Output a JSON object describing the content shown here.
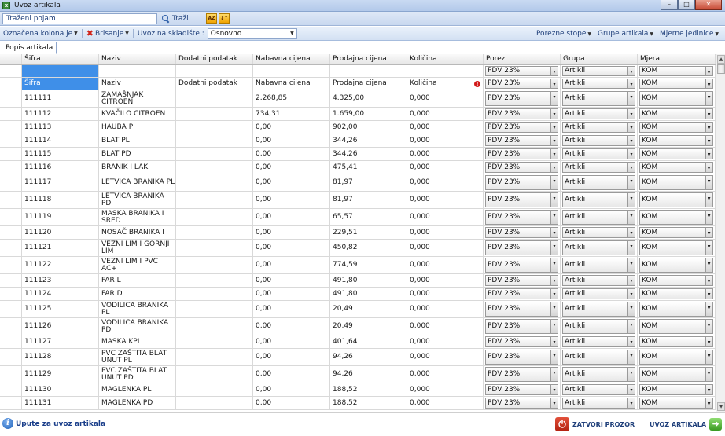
{
  "window": {
    "title": "Uvoz artikala",
    "minimize": "–",
    "maximize": "□",
    "close": "✕"
  },
  "search": {
    "value": "Traženi pojam",
    "button_label": "Traži",
    "sort_az_label": "AZ",
    "sort_desc_label": "↓↑"
  },
  "toolbar": {
    "marked_column_label": "Označena kolona je",
    "delete_label": "Brisanje",
    "import_to_warehouse_label": "Uvoz na skladište :",
    "warehouse_value": "Osnovno",
    "tax_rates_label": "Porezne stope",
    "item_groups_label": "Grupe artikala",
    "units_label": "Mjerne jedinice"
  },
  "tab": {
    "label": "Popis artikala"
  },
  "columns": [
    "Šifra",
    "Naziv",
    "Dodatni podatak",
    "Nabavna cijena",
    "Prodajna cijena",
    "Količina",
    "Porez",
    "Grupa",
    "Mjera"
  ],
  "filter_row": {
    "porez": "PDV 23%",
    "grupa": "Artikli",
    "mjera": "KOM"
  },
  "colname_row": [
    "Šifra",
    "Naziv",
    "Dodatni podatak",
    "Nabavna cijena",
    "Prodajna cijena",
    "Količina",
    "PDV 23%",
    "Artikli",
    "KOM"
  ],
  "rows": [
    {
      "sifra": "111111",
      "naziv": "ZAMAŠNJAK CITROEN",
      "dodatni": "",
      "nabavna": "2.268,85",
      "prodajna": "4.325,00",
      "kolicina": "0,000",
      "porez": "PDV 23%",
      "grupa": "Artikli",
      "mjera": "KOM"
    },
    {
      "sifra": "111112",
      "naziv": "KVAČILO CITROEN",
      "dodatni": "",
      "nabavna": "734,31",
      "prodajna": "1.659,00",
      "kolicina": "0,000",
      "porez": "PDV 23%",
      "grupa": "Artikli",
      "mjera": "KOM"
    },
    {
      "sifra": "111113",
      "naziv": "HAUBA P",
      "dodatni": "",
      "nabavna": "0,00",
      "prodajna": "902,00",
      "kolicina": "0,000",
      "porez": "PDV 23%",
      "grupa": "Artikli",
      "mjera": "KOM"
    },
    {
      "sifra": "111114",
      "naziv": "BLAT PL",
      "dodatni": "",
      "nabavna": "0,00",
      "prodajna": "344,26",
      "kolicina": "0,000",
      "porez": "PDV 23%",
      "grupa": "Artikli",
      "mjera": "KOM"
    },
    {
      "sifra": "111115",
      "naziv": "BLAT PD",
      "dodatni": "",
      "nabavna": "0,00",
      "prodajna": "344,26",
      "kolicina": "0,000",
      "porez": "PDV 23%",
      "grupa": "Artikli",
      "mjera": "KOM"
    },
    {
      "sifra": "111116",
      "naziv": "BRANIK I LAK",
      "dodatni": "",
      "nabavna": "0,00",
      "prodajna": "475,41",
      "kolicina": "0,000",
      "porez": "PDV 23%",
      "grupa": "Artikli",
      "mjera": "KOM"
    },
    {
      "sifra": "111117",
      "naziv": "LETVICA BRANIKA PL",
      "dodatni": "",
      "nabavna": "0,00",
      "prodajna": "81,97",
      "kolicina": "0,000",
      "porez": "PDV 23%",
      "grupa": "Artikli",
      "mjera": "KOM"
    },
    {
      "sifra": "111118",
      "naziv": "LETVICA BRANIKA PD",
      "dodatni": "",
      "nabavna": "0,00",
      "prodajna": "81,97",
      "kolicina": "0,000",
      "porez": "PDV 23%",
      "grupa": "Artikli",
      "mjera": "KOM"
    },
    {
      "sifra": "111119",
      "naziv": "MASKA BRANIKA I SRED",
      "dodatni": "",
      "nabavna": "0,00",
      "prodajna": "65,57",
      "kolicina": "0,000",
      "porez": "PDV 23%",
      "grupa": "Artikli",
      "mjera": "KOM"
    },
    {
      "sifra": "111120",
      "naziv": "NOSAČ BRANIKA I",
      "dodatni": "",
      "nabavna": "0,00",
      "prodajna": "229,51",
      "kolicina": "0,000",
      "porez": "PDV 23%",
      "grupa": "Artikli",
      "mjera": "KOM"
    },
    {
      "sifra": "111121",
      "naziv": "VEZNI LIM I GORNJI LIM",
      "dodatni": "",
      "nabavna": "0,00",
      "prodajna": "450,82",
      "kolicina": "0,000",
      "porez": "PDV 23%",
      "grupa": "Artikli",
      "mjera": "KOM"
    },
    {
      "sifra": "111122",
      "naziv": "VEZNI LIM I PVC AC+",
      "dodatni": "",
      "nabavna": "0,00",
      "prodajna": "774,59",
      "kolicina": "0,000",
      "porez": "PDV 23%",
      "grupa": "Artikli",
      "mjera": "KOM"
    },
    {
      "sifra": "111123",
      "naziv": "FAR L",
      "dodatni": "",
      "nabavna": "0,00",
      "prodajna": "491,80",
      "kolicina": "0,000",
      "porez": "PDV 23%",
      "grupa": "Artikli",
      "mjera": "KOM"
    },
    {
      "sifra": "111124",
      "naziv": "FAR D",
      "dodatni": "",
      "nabavna": "0,00",
      "prodajna": "491,80",
      "kolicina": "0,000",
      "porez": "PDV 23%",
      "grupa": "Artikli",
      "mjera": "KOM"
    },
    {
      "sifra": "111125",
      "naziv": "VODILICA BRANIKA PL",
      "dodatni": "",
      "nabavna": "0,00",
      "prodajna": "20,49",
      "kolicina": "0,000",
      "porez": "PDV 23%",
      "grupa": "Artikli",
      "mjera": "KOM"
    },
    {
      "sifra": "111126",
      "naziv": "VODILICA BRANIKA PD",
      "dodatni": "",
      "nabavna": "0,00",
      "prodajna": "20,49",
      "kolicina": "0,000",
      "porez": "PDV 23%",
      "grupa": "Artikli",
      "mjera": "KOM"
    },
    {
      "sifra": "111127",
      "naziv": "MASKA KPL",
      "dodatni": "",
      "nabavna": "0,00",
      "prodajna": "401,64",
      "kolicina": "0,000",
      "porez": "PDV 23%",
      "grupa": "Artikli",
      "mjera": "KOM"
    },
    {
      "sifra": "111128",
      "naziv": "PVC ZAŠTITA BLAT UNUT PL",
      "dodatni": "",
      "nabavna": "0,00",
      "prodajna": "94,26",
      "kolicina": "0,000",
      "porez": "PDV 23%",
      "grupa": "Artikli",
      "mjera": "KOM"
    },
    {
      "sifra": "111129",
      "naziv": "PVC ZAŠTITA BLAT UNUT PD",
      "dodatni": "",
      "nabavna": "0,00",
      "prodajna": "94,26",
      "kolicina": "0,000",
      "porez": "PDV 23%",
      "grupa": "Artikli",
      "mjera": "KOM"
    },
    {
      "sifra": "111130",
      "naziv": "MAGLENKA PL",
      "dodatni": "",
      "nabavna": "0,00",
      "prodajna": "188,52",
      "kolicina": "0,000",
      "porez": "PDV 23%",
      "grupa": "Artikli",
      "mjera": "KOM"
    },
    {
      "sifra": "111131",
      "naziv": "MAGLENKA PD",
      "dodatni": "",
      "nabavna": "0,00",
      "prodajna": "188,52",
      "kolicina": "0,000",
      "porez": "PDV 23%",
      "grupa": "Artikli",
      "mjera": "KOM"
    }
  ],
  "footer": {
    "help_link": "Upute za uvoz artikala",
    "close_label": "ZATVORI PROZOR",
    "import_label": "UVOZ ARTIKALA"
  },
  "colors": {
    "selection_blue": "#3f8fe8",
    "toolbar_blue": "#1f3f7a",
    "error_red": "#d21a1a"
  }
}
